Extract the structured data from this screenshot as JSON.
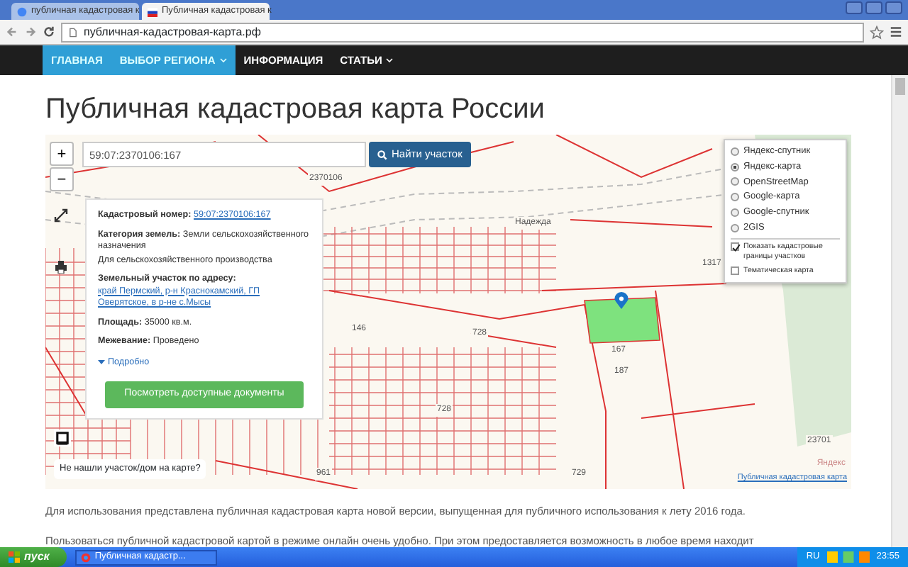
{
  "browser": {
    "tabs": [
      {
        "title": "публичная кадастровая к",
        "selected": false
      },
      {
        "title": "Публичная кадастровая к",
        "selected": true
      }
    ],
    "address": "публичная-кадастровая-карта.рф"
  },
  "nav": [
    {
      "label": "ГЛАВНАЯ",
      "highlighted": true,
      "dropdown": false
    },
    {
      "label": "ВЫБОР РЕГИОНА",
      "highlighted": true,
      "dropdown": true
    },
    {
      "label": "ИНФОРМАЦИЯ",
      "highlighted": false,
      "dropdown": false
    },
    {
      "label": "СТАТЬИ",
      "highlighted": false,
      "dropdown": true
    }
  ],
  "heading": "Публичная кадастровая карта России",
  "map": {
    "search": {
      "value": "59:07:2370106:167"
    },
    "search_button": "Найти участок",
    "zoom_in": "+",
    "zoom_out": "−",
    "popup": {
      "fields": [
        {
          "label": "Кадастровый номер:",
          "value": "59:07:2370106:167",
          "link": true
        },
        {
          "label": "Категория земель:",
          "value": "Земли сельскохозяйственного назначения",
          "link": false
        },
        {
          "label": "Земельный участок по адресу:",
          "value": "край Пермский, р-н Краснокамский, ГП Оверятское, в р-не с.Мысы",
          "link": true
        },
        {
          "label": "Площадь:",
          "value": "35000 кв.м.",
          "link": false
        },
        {
          "label": "Межевание:",
          "value": "Проведено",
          "link": false
        }
      ],
      "use": "Для сельскохозяйственного производства",
      "more": "Подробно",
      "button": "Посмотреть доступные документы"
    },
    "layers": [
      {
        "label": "Яндекс-спутник",
        "selected": false
      },
      {
        "label": "Яндекс-карта",
        "selected": true
      },
      {
        "label": "OpenStreetMap",
        "selected": false
      },
      {
        "label": "Google-карта",
        "selected": false
      },
      {
        "label": "Google-спутник",
        "selected": false
      },
      {
        "label": "2GIS",
        "selected": false
      }
    ],
    "overlays": [
      {
        "label": "Показать кадастровые границы участков",
        "checked": true
      },
      {
        "label": "Тематическая карта",
        "checked": false
      }
    ],
    "labels": [
      "2370106",
      "Надежда",
      "1317",
      "146",
      "728",
      "167",
      "187",
      "728",
      "961",
      "729",
      "23701"
    ],
    "not_found": "Не нашли участок/дом на карте?",
    "provider": "Яндекс",
    "attribution": "Публичная кадастровая карта"
  },
  "paragraphs": [
    "Для использования представлена публичная кадастровая карта новой версии, выпущенная для публичного использования к лету 2016 года.",
    "Пользоваться публичной кадастровой картой в режиме онлайн очень удобно. При этом предоставляется возможность в любое время находит"
  ],
  "taskbar": {
    "start": "пуск",
    "task": "Публичная кадастр...",
    "lang": "RU",
    "clock": "23:55"
  }
}
